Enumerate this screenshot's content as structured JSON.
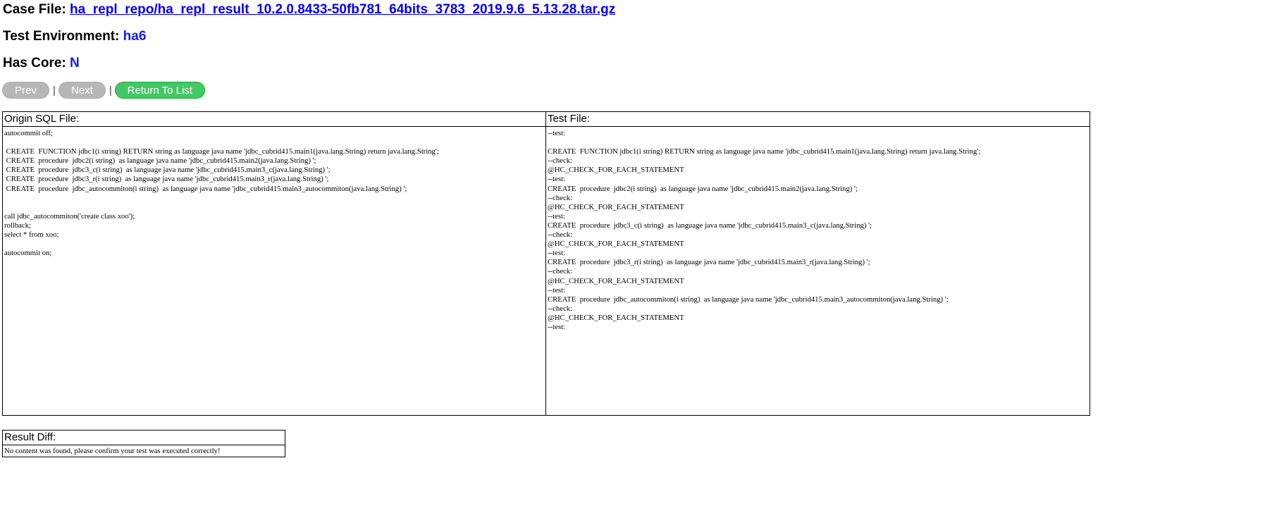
{
  "case_file": {
    "label": "Case File:",
    "value": "ha_repl_repo/ha_repl_result_10.2.0.8433-50fb781_64bits_3783_2019.9.6_5.13.28.tar.gz"
  },
  "test_environment": {
    "label": "Test Environment:",
    "value": "ha6"
  },
  "has_core": {
    "label": "Has Core:",
    "value": "N"
  },
  "nav": {
    "prev_label": "Prev",
    "separator": "|",
    "next_label": "Next",
    "return_label": "Return To List"
  },
  "origin_sql": {
    "header": "Origin SQL File:",
    "content": "autocommit off;\n\n CREATE  FUNCTION jdbc1(i string) RETURN string as language java name 'jdbc_cubrid415.main1(java.lang.String) return java.lang.String';\n CREATE  procedure  jdbc2(i string)  as language java name 'jdbc_cubrid415.main2(java.lang.String) ';\n CREATE  procedure  jdbc3_c(i string)  as language java name 'jdbc_cubrid415.main3_c(java.lang.String) ';\n CREATE  procedure  jdbc3_r(i string)  as language java name 'jdbc_cubrid415.main3_r(java.lang.String) ';\n CREATE  procedure  jdbc_autocommiton(i string)  as language java name 'jdbc_cubrid415.main3_autocommiton(java.lang.String) ';\n\n\ncall jdbc_autocommiton('create class xoo');\nrollback;\nselect * from xoo;\n\nautocommit on;"
  },
  "test_file": {
    "header": "Test File:",
    "content": "--test:\n\nCREATE  FUNCTION jdbc1(i string) RETURN string as language java name 'jdbc_cubrid415.main1(java.lang.String) return java.lang.String';\n--check:\n@HC_CHECK_FOR_EACH_STATEMENT\n--test:\nCREATE  procedure  jdbc2(i string)  as language java name 'jdbc_cubrid415.main2(java.lang.String) ';\n--check:\n@HC_CHECK_FOR_EACH_STATEMENT\n--test:\nCREATE  procedure  jdbc3_c(i string)  as language java name 'jdbc_cubrid415.main3_c(java.lang.String) ';\n--check:\n@HC_CHECK_FOR_EACH_STATEMENT\n--test:\nCREATE  procedure  jdbc3_r(i string)  as language java name 'jdbc_cubrid415.main3_r(java.lang.String) ';\n--check:\n@HC_CHECK_FOR_EACH_STATEMENT\n--test:\nCREATE  procedure  jdbc_autocommiton(i string)  as language java name 'jdbc_cubrid415.main3_autocommiton(java.lang.String) ';\n--check:\n@HC_CHECK_FOR_EACH_STATEMENT\n--test:"
  },
  "result_diff": {
    "header": "Result Diff:",
    "message": "No content was found, please confirm your test was executed correctly!"
  },
  "colors": {
    "link": "#0000ee",
    "value": "#1a1af0",
    "button_gray": "#b7b7b7",
    "button_green": "#44c767"
  }
}
